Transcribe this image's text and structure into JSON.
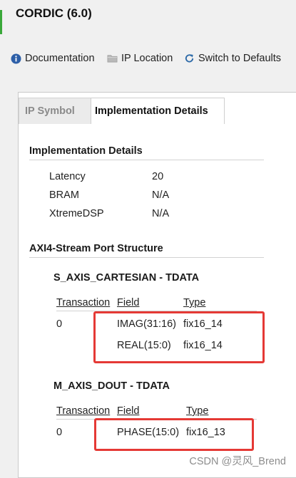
{
  "window": {
    "title": "CORDIC (6.0)"
  },
  "toolbar": {
    "documentation": "Documentation",
    "ip_location": "IP Location",
    "switch_defaults": "Switch to Defaults"
  },
  "tabs": [
    {
      "label": "IP Symbol",
      "active": false
    },
    {
      "label": "Implementation Details",
      "active": true
    }
  ],
  "impl": {
    "section_title": "Implementation Details",
    "rows": [
      {
        "label": "Latency",
        "value": "20"
      },
      {
        "label": "BRAM",
        "value": "N/A"
      },
      {
        "label": "XtremeDSP",
        "value": "N/A"
      }
    ]
  },
  "axi": {
    "section_title": "AXI4-Stream Port Structure",
    "ports": [
      {
        "title": "S_AXIS_CARTESIAN - TDATA",
        "headers": {
          "transaction": "Transaction",
          "field": "Field",
          "type": "Type"
        },
        "transaction": "0",
        "fields": [
          {
            "field": "IMAG(31:16)",
            "type": "fix16_14"
          },
          {
            "field": "REAL(15:0)",
            "type": "fix16_14"
          }
        ]
      },
      {
        "title": "M_AXIS_DOUT - TDATA",
        "headers": {
          "transaction": "Transaction",
          "field": "Field",
          "type": "Type"
        },
        "transaction": "0",
        "fields": [
          {
            "field": "PHASE(15:0)",
            "type": "fix16_13"
          }
        ]
      }
    ]
  },
  "watermark": "CSDN @灵风_Brend",
  "colors": {
    "highlight": "#e53935",
    "info_icon": "#2d5fa8",
    "refresh_icon": "#2d6aa8"
  }
}
